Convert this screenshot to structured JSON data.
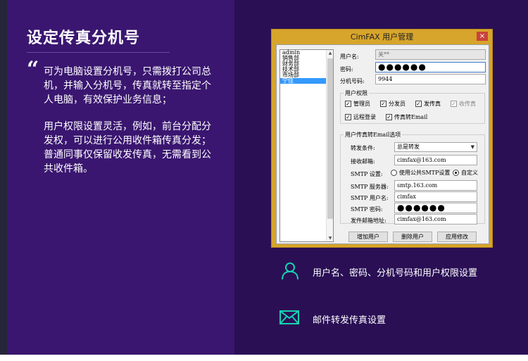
{
  "heading": {
    "title": "设定传真分机号",
    "quote": "“",
    "paragraph1": "可为电脑设置分机号，只需拨打公司总机，并输入分机号，传真就转至指定个人电脑，有效保护业务信息；",
    "paragraph2": "用户权限设置灵活，例如，前台分配分发权，可以进行公用收件箱传真分发；普通同事仅保留收发传真，无需看到公共收件箱。"
  },
  "window": {
    "title": "CimFAX 用户管理",
    "close_label": "×",
    "user_list": [
      "admin",
      "销售部",
      "财务部",
      "技术部",
      "市场部",
      "宁佳"
    ],
    "selected_index": 5,
    "username_label": "用户名:",
    "username_value": "关**",
    "password_label": "密码:",
    "password_value": "●●●●●●",
    "extension_label": "分机号码:",
    "extension_value": "9944",
    "permissions_title": "用户权限",
    "permissions": [
      {
        "label": "管理员",
        "checked": true,
        "enabled": true
      },
      {
        "label": "分发员",
        "checked": true,
        "enabled": true
      },
      {
        "label": "发传真",
        "checked": true,
        "enabled": true
      },
      {
        "label": "收传真",
        "checked": true,
        "enabled": false
      },
      {
        "label": "远程登录",
        "checked": true,
        "enabled": true
      },
      {
        "label": "传真转Email",
        "checked": true,
        "enabled": true
      }
    ],
    "email_group_title": "用户传真转Email选项",
    "forward_condition_label": "转发条件:",
    "forward_condition_value": "总是转发",
    "receive_mail_label": "接收邮箱:",
    "receive_mail_value": "cimfax@163.com",
    "smtp_setting_label": "SMTP 设置:",
    "smtp_options": [
      {
        "label": "使用公共SMTP设置",
        "selected": false
      },
      {
        "label": "自定义",
        "selected": true
      }
    ],
    "smtp_server_label": "SMTP 服务器:",
    "smtp_server_value": "smtp.163.com",
    "smtp_user_label": "SMTP 用户名:",
    "smtp_user_value": "cimfax",
    "smtp_password_label": "SMTP 密码:",
    "smtp_password_value": "●●●●●●",
    "sender_label": "发件邮箱地址:",
    "sender_value": "cimfax@163.com",
    "buttons": {
      "add": "增加用户",
      "delete": "删除用户",
      "apply": "应用修改"
    }
  },
  "features": [
    {
      "icon": "user-icon",
      "label": "用户名、密码、分机号码和用户权限设置"
    },
    {
      "icon": "envelope-icon",
      "label": "邮件转发传真设置"
    }
  ],
  "colors": {
    "left_panel": "#3a1670",
    "right_panel": "#2a0f55",
    "accent_icon": "#17d4b0",
    "window_frame": "#d7a52b"
  }
}
